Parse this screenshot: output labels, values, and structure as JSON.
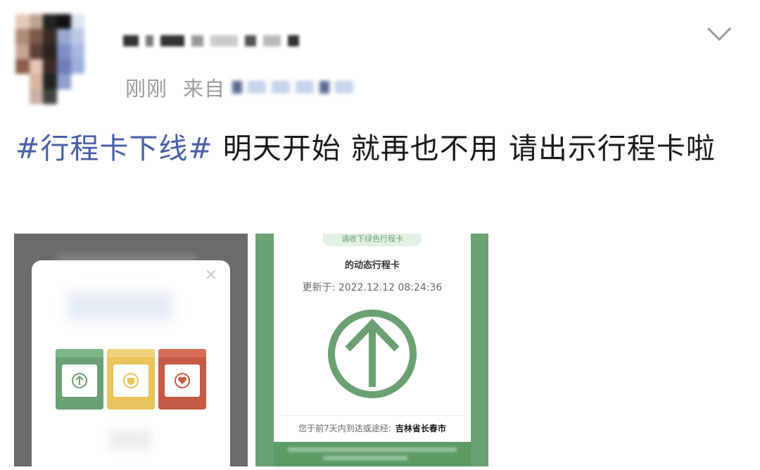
{
  "post": {
    "time": "刚刚",
    "source_prefix": "来自",
    "hashtag": "#行程卡下线#",
    "text": " 明天开始 就再也不用 请出示行程卡啦"
  },
  "icons": {
    "menu": "chevron-down-icon",
    "close": "close-icon",
    "arrow": "up-arrow-icon"
  },
  "image2": {
    "tab_label": "请收下绿色行程卡",
    "title": "的动态行程卡",
    "updated": "更新于: 2022.12.12 08:24:36",
    "foot_label": "您于前7天内到达或途经:",
    "foot_place": "吉林省长春市"
  },
  "dialog": {
    "close_glyph": "×"
  },
  "colors": {
    "hashtag": "#4a5ea8",
    "green": "#6aa072",
    "yellow": "#e9c35b",
    "red": "#c55a45"
  }
}
